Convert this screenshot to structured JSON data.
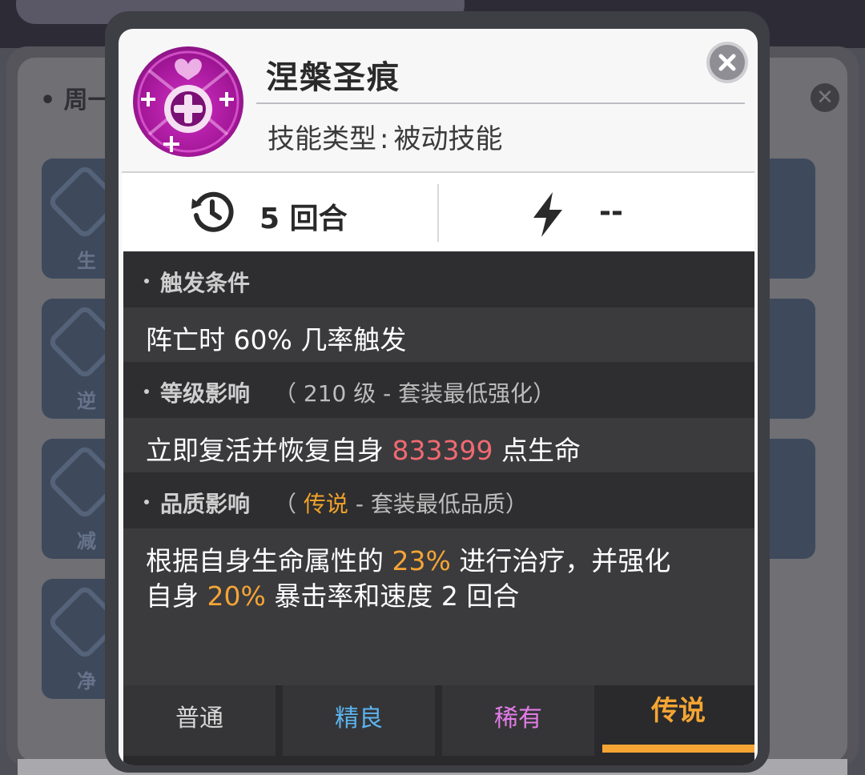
{
  "background": {
    "title": "• 周一",
    "tile_labels": [
      "生",
      "逆",
      "减",
      "净"
    ]
  },
  "skill": {
    "name": "涅槃圣痕",
    "type_label": "技能类型",
    "type_separator": ":",
    "type_value": "被动技能",
    "icon": "nirvana-cross-icon"
  },
  "stats": {
    "cooldown_value": "5 回合",
    "cooldown_icon": "timer-icon",
    "energy_value": "--",
    "energy_icon": "lightning-icon"
  },
  "sections": {
    "trigger": {
      "header": "触发条件",
      "body": "阵亡时 60% 几率触发"
    },
    "level": {
      "header": "等级影响",
      "note_open": "（ 210 级 - 套装最低强化）",
      "body_prefix": "立即复活并恢复自身 ",
      "body_value": "833399",
      "body_suffix": " 点生命"
    },
    "quality": {
      "header": "品质影响",
      "note_open": "（ ",
      "note_highlight": "传说",
      "note_rest": " - 套装最低品质）",
      "line1_prefix": "根据自身生命属性的 ",
      "line1_value": "23%",
      "line1_suffix": " 进行治疗，并强化",
      "line2_prefix": "自身 ",
      "line2_value": "20%",
      "line2_suffix": " 暴击率和速度 2 回合"
    }
  },
  "tabs": [
    {
      "label": "普通",
      "color": "#d7d7d7"
    },
    {
      "label": "精良",
      "color": "#5bb4f0"
    },
    {
      "label": "稀有",
      "color": "#e27ce8"
    },
    {
      "label": "传说",
      "color": "#f5a534",
      "active": true
    }
  ],
  "colors": {
    "accent": "#f5a534",
    "highlight_red": "#f06a72",
    "icon_magenta": "#c325b9"
  }
}
